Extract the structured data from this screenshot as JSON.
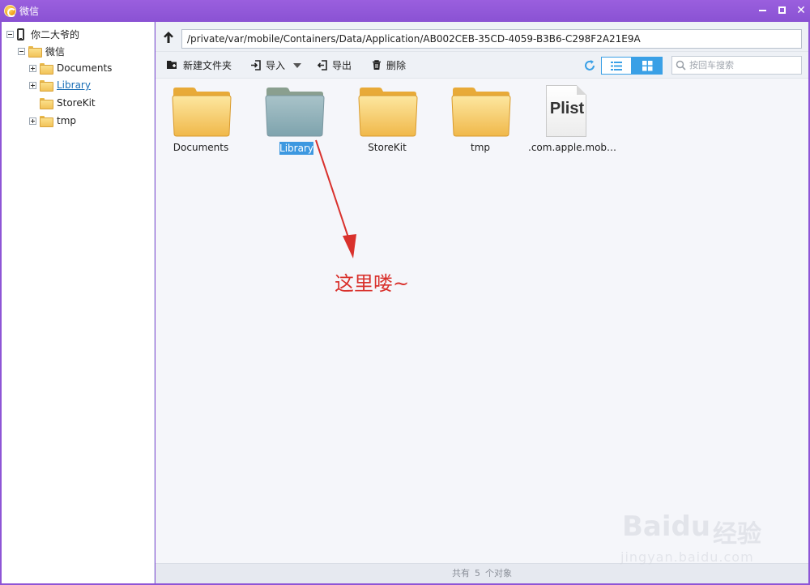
{
  "window": {
    "title": "微信",
    "accent_color": "#8e55d6"
  },
  "sidebar": {
    "root_label": "你二大爷的",
    "app_label": "微信",
    "items": [
      {
        "label": "Documents",
        "expandable": true
      },
      {
        "label": "Library",
        "expandable": true,
        "selected": true
      },
      {
        "label": "StoreKit",
        "expandable": false
      },
      {
        "label": "tmp",
        "expandable": true
      }
    ]
  },
  "addressbar": {
    "path": "/private/var/mobile/Containers/Data/Application/AB002CEB-35CD-4059-B3B6-C298F2A21E9A"
  },
  "toolbar": {
    "new_folder_label": "新建文件夹",
    "import_label": "导入",
    "export_label": "导出",
    "delete_label": "删除",
    "search_placeholder": "按回车搜索",
    "view_mode": "grid"
  },
  "files": [
    {
      "name": "Documents",
      "type": "folder"
    },
    {
      "name": "Library",
      "type": "folder",
      "selected": true
    },
    {
      "name": "StoreKit",
      "type": "folder"
    },
    {
      "name": "tmp",
      "type": "folder"
    },
    {
      "name": ".com.apple.mobil...",
      "type": "plist",
      "icon_text": "Plist"
    }
  ],
  "annotation": {
    "text": "这里喽~",
    "color": "#d9312c"
  },
  "statusbar": {
    "prefix": "共有",
    "count": "5",
    "suffix": "个对象"
  },
  "watermark": {
    "logo": "Baidu",
    "logo_cn": "经验",
    "url": "jingyan.baidu.com"
  }
}
